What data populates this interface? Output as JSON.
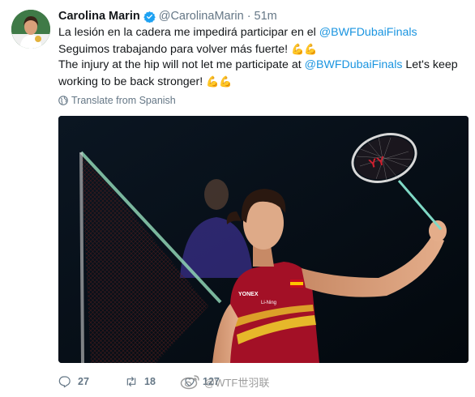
{
  "tweet": {
    "author_name": "Carolina Marin",
    "author_handle": "@CarolinaMarin",
    "separator": "·",
    "time": "51m",
    "text_es_before": "La lesión en la cadera me impedirá participar en el ",
    "mention_1": "@BWFDubaiFinals",
    "text_es_after": " Seguimos trabajando para volver más fuerte! ",
    "text_en_before": "The injury at the hip will not let me participate at ",
    "mention_2": "@BWFDubaiFinals",
    "text_en_after": " Let's keep working to be back stronger! ",
    "emoji_flex": "💪💪",
    "translate_label": "Translate from Spanish"
  },
  "actions": {
    "reply_count": "27",
    "retweet_count": "18",
    "like_count": "127"
  },
  "watermark": {
    "text": "@WTF世羽联"
  },
  "photo": {
    "jersey_text": "YONEX",
    "sponsor_text": "Li-Ning",
    "racket_logo": "YY"
  },
  "colors": {
    "link": "#1b95e0",
    "muted": "#657786",
    "verified": "#1da1f2",
    "jersey": "#b3122b",
    "court_net": "#8fd4b4"
  },
  "icons": [
    "verified-badge-icon",
    "globe-icon",
    "reply-icon",
    "retweet-icon",
    "like-icon",
    "weibo-icon"
  ]
}
